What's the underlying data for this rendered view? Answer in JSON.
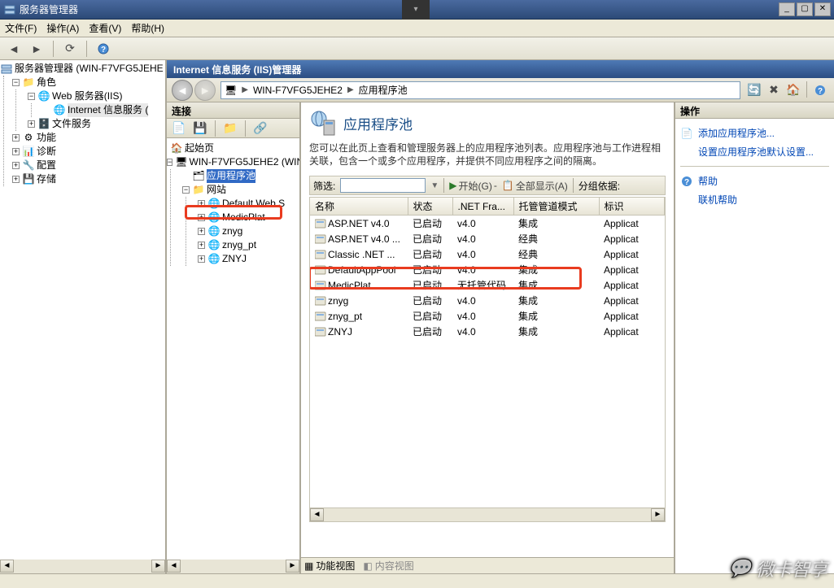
{
  "window": {
    "title": "服务器管理器"
  },
  "menus": {
    "file": "文件(F)",
    "action": "操作(A)",
    "view": "查看(V)",
    "help": "帮助(H)"
  },
  "left_tree": {
    "root": "服务器管理器 (WIN-F7VFG5JEHE",
    "roles": "角色",
    "web_iis": "Web 服务器(IIS)",
    "iis": "Internet 信息服务 (",
    "file_svc": "文件服务",
    "features": "功能",
    "diag": "诊断",
    "config": "配置",
    "storage": "存储"
  },
  "iis": {
    "title": "Internet 信息服务 (IIS)管理器",
    "breadcrumb": {
      "host": "WIN-F7VFG5JEHE2",
      "node": "应用程序池"
    },
    "conn": {
      "header": "连接"
    },
    "conn_tree": {
      "start": "起始页",
      "host": "WIN-F7VFG5JEHE2 (WIN",
      "apppools": "应用程序池",
      "sites": "网站",
      "defaultweb": "Default Web S",
      "medicplat": "MedicPlat",
      "znyg": "znyg",
      "znyg_pt": "znyg_pt",
      "znyj_u": "ZNYJ"
    },
    "center": {
      "heading": "应用程序池",
      "desc": "您可以在此页上查看和管理服务器上的应用程序池列表。应用程序池与工作进程相关联，包含一个或多个应用程序，并提供不同应用程序之间的隔离。",
      "filter_label": "筛选:",
      "start_label": "开始(G)",
      "showall": "全部显示(A)",
      "groupby": "分组依据:",
      "cols": {
        "name": "名称",
        "status": "状态",
        "net": ".NET Fra...",
        "pipeline": "托管管道模式",
        "identity": "标识"
      },
      "rows": [
        {
          "name": "ASP.NET v4.0",
          "status": "已启动",
          "net": "v4.0",
          "pipeline": "集成",
          "identity": "Applicat"
        },
        {
          "name": "ASP.NET v4.0 ...",
          "status": "已启动",
          "net": "v4.0",
          "pipeline": "经典",
          "identity": "Applicat"
        },
        {
          "name": "Classic .NET ...",
          "status": "已启动",
          "net": "v4.0",
          "pipeline": "经典",
          "identity": "Applicat"
        },
        {
          "name": "DefaultAppPool",
          "status": "已启动",
          "net": "v4.0",
          "pipeline": "集成",
          "identity": "Applicat"
        },
        {
          "name": "MedicPlat",
          "status": "已启动",
          "net": "无托管代码",
          "pipeline": "集成",
          "identity": "Applicat"
        },
        {
          "name": "znyg",
          "status": "已启动",
          "net": "v4.0",
          "pipeline": "集成",
          "identity": "Applicat"
        },
        {
          "name": "znyg_pt",
          "status": "已启动",
          "net": "v4.0",
          "pipeline": "集成",
          "identity": "Applicat"
        },
        {
          "name": "ZNYJ",
          "status": "已启动",
          "net": "v4.0",
          "pipeline": "集成",
          "identity": "Applicat"
        }
      ],
      "tab_feature": "功能视图",
      "tab_content": "内容视图"
    },
    "actions": {
      "header": "操作",
      "add": "添加应用程序池...",
      "defaults": "设置应用程序池默认设置...",
      "help": "帮助",
      "online": "联机帮助"
    }
  },
  "watermark": "微卡智享"
}
